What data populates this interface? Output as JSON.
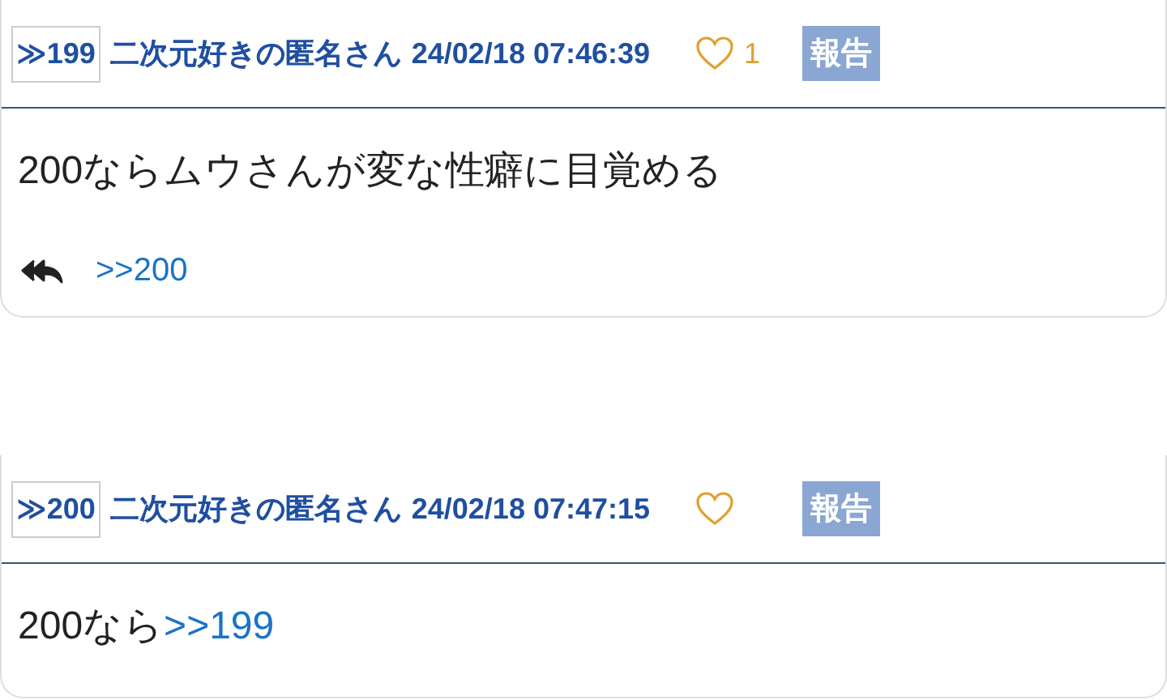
{
  "posts": [
    {
      "number": "≫199",
      "author": "二次元好きの匿名さん",
      "date": "24/02/18 07:46:39",
      "likes": "1",
      "report": "報告",
      "body": [
        {
          "kind": "text",
          "text": "200ならムウさんが変な性癖に目覚める"
        }
      ],
      "replies": [
        ">>200"
      ]
    },
    {
      "number": "≫200",
      "author": "二次元好きの匿名さん",
      "date": "24/02/18 07:47:15",
      "report": "報告",
      "body": [
        {
          "kind": "text",
          "text": "200なら"
        },
        {
          "kind": "link",
          "text": ">>199"
        }
      ]
    }
  ]
}
